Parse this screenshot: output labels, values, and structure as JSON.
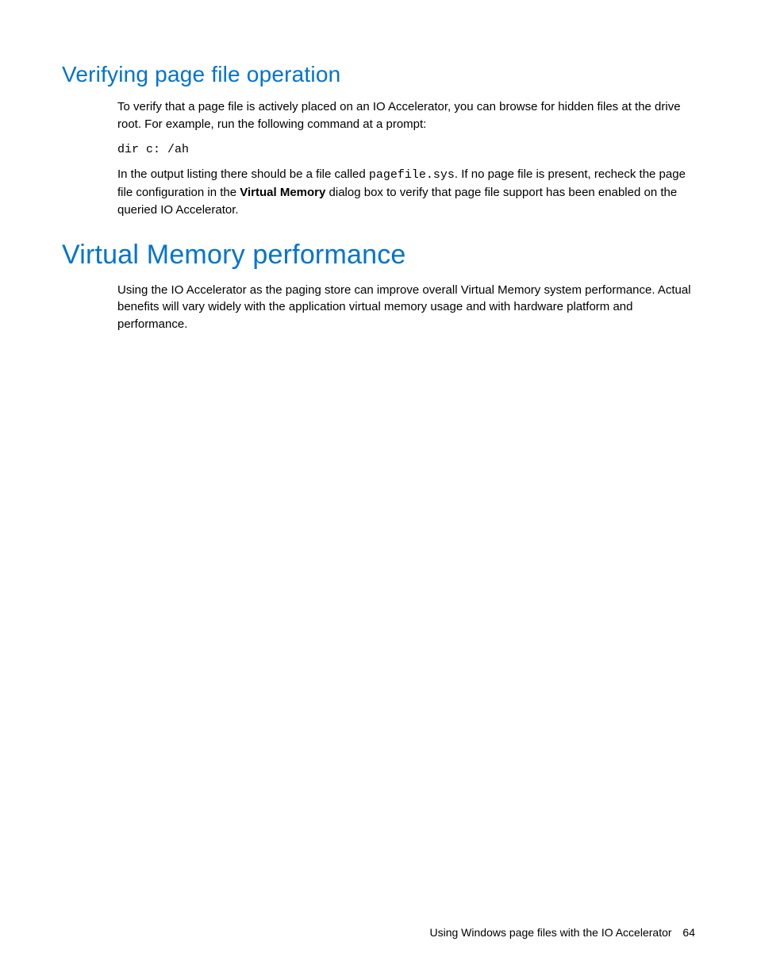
{
  "section1": {
    "heading": "Verifying page file operation",
    "p1": "To verify that a page file is actively placed on an IO Accelerator, you can browse for hidden files at the drive root. For example, run the following command at a prompt:",
    "code": "dir c: /ah",
    "p2a": "In the output listing there should be a file called ",
    "p2_code": "pagefile.sys",
    "p2b": ". If no page file is present, recheck the page file configuration in the ",
    "p2_bold": "Virtual Memory",
    "p2c": " dialog box to verify that page file support has been enabled on the queried IO Accelerator."
  },
  "section2": {
    "heading": "Virtual Memory performance",
    "p1": "Using the IO Accelerator as the paging store can improve overall Virtual Memory system performance. Actual benefits will vary widely with the application virtual memory usage and with hardware platform and performance."
  },
  "footer": {
    "title": "Using Windows page files with the IO Accelerator",
    "page": "64"
  }
}
